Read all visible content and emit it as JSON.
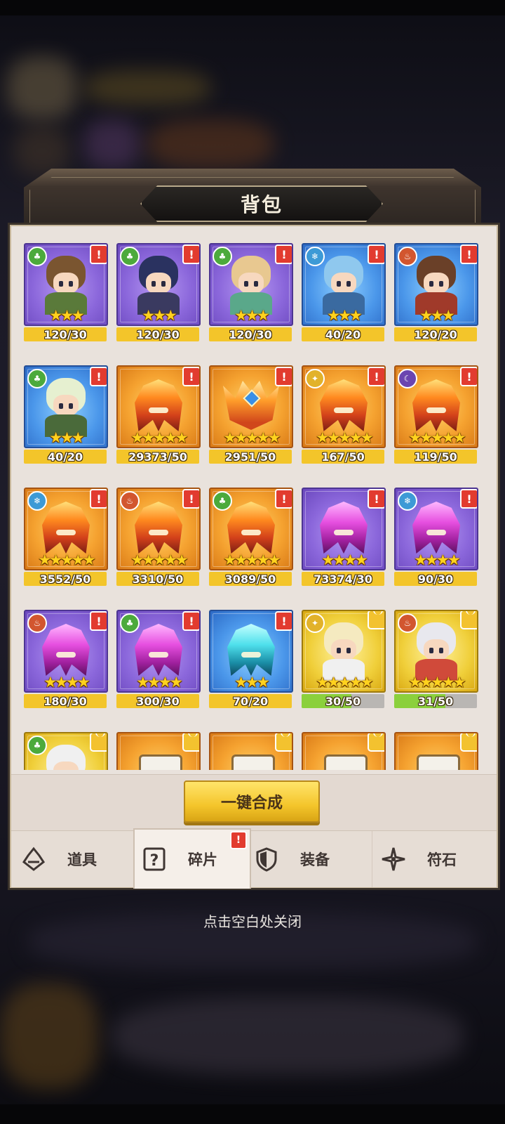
{
  "window": {
    "title": "背包"
  },
  "items": [
    {
      "kind": "hero",
      "rarity": "purple",
      "element": "green",
      "badge": "alert",
      "stars": 3,
      "count": "120/30",
      "hair": "#7a5530",
      "cloth": "#5a7a3a"
    },
    {
      "kind": "hero",
      "rarity": "purple",
      "element": "green",
      "badge": "alert",
      "stars": 3,
      "count": "120/30",
      "hair": "#2a3260",
      "cloth": "#3a3a60"
    },
    {
      "kind": "hero",
      "rarity": "purple",
      "element": "green",
      "badge": "alert",
      "stars": 3,
      "count": "120/30",
      "hair": "#e8c890",
      "cloth": "#5aa88a"
    },
    {
      "kind": "hero",
      "rarity": "blue",
      "element": "ice",
      "badge": "alert",
      "stars": 3,
      "count": "40/20",
      "hair": "#8fc8ee",
      "cloth": "#3a6aa0"
    },
    {
      "kind": "hero",
      "rarity": "blue",
      "element": "fire",
      "badge": "alert",
      "stars": 3,
      "count": "120/20",
      "hair": "#6a4028",
      "cloth": "#a03a2a"
    },
    {
      "kind": "hero",
      "rarity": "blue",
      "element": "green",
      "badge": "alert",
      "stars": 3,
      "count": "40/20",
      "hair": "#e6f0d0",
      "cloth": "#4a6a3a"
    },
    {
      "kind": "helm",
      "rarity": "orange",
      "style": "fire",
      "badge": "alert",
      "stars": 5,
      "count": "29373/50"
    },
    {
      "kind": "crown",
      "rarity": "orange",
      "badge": "alert",
      "stars": 5,
      "count": "2951/50"
    },
    {
      "kind": "helm",
      "rarity": "orange",
      "style": "fire",
      "element": "light",
      "badge": "alert",
      "stars": 5,
      "count": "167/50"
    },
    {
      "kind": "helm",
      "rarity": "orange",
      "style": "fire",
      "element": "dark",
      "badge": "alert",
      "stars": 5,
      "count": "119/50"
    },
    {
      "kind": "helm",
      "rarity": "orange",
      "style": "fire",
      "element": "ice",
      "badge": "alert",
      "stars": 5,
      "count": "3552/50"
    },
    {
      "kind": "helm",
      "rarity": "orange",
      "style": "fire",
      "element": "fire",
      "badge": "alert",
      "stars": 5,
      "count": "3310/50"
    },
    {
      "kind": "helm",
      "rarity": "orange",
      "style": "fire",
      "element": "green",
      "badge": "alert",
      "stars": 5,
      "count": "3089/50"
    },
    {
      "kind": "helm",
      "rarity": "purple",
      "style": "pink",
      "badge": "alert",
      "stars": 4,
      "count": "73374/30"
    },
    {
      "kind": "helm",
      "rarity": "purple",
      "style": "pink",
      "element": "ice",
      "badge": "alert",
      "stars": 4,
      "count": "90/30"
    },
    {
      "kind": "helm",
      "rarity": "purple",
      "style": "pink",
      "element": "fire",
      "badge": "alert",
      "stars": 4,
      "count": "180/30"
    },
    {
      "kind": "helm",
      "rarity": "purple",
      "style": "pink",
      "element": "green",
      "badge": "alert",
      "stars": 4,
      "count": "300/30"
    },
    {
      "kind": "helm",
      "rarity": "blue",
      "style": "cyan",
      "badge": "alert",
      "stars": 3,
      "count": "70/20"
    },
    {
      "kind": "hero",
      "rarity": "gold",
      "element": "light",
      "badge": "puzzle",
      "stars": 5,
      "count": "30/50",
      "progress": 0.6,
      "hair": "#f5eac0",
      "cloth": "#f0f0f0"
    },
    {
      "kind": "hero",
      "rarity": "gold",
      "element": "fire",
      "badge": "puzzle",
      "stars": 5,
      "count": "31/50",
      "progress": 0.62,
      "hair": "#e8e8ee",
      "cloth": "#d04a3a"
    },
    {
      "kind": "hero",
      "rarity": "gold",
      "element": "green",
      "badge": "puzzle",
      "stars": 0,
      "count": "",
      "hair": "#f0f0f0",
      "cloth": "#f0f0f0"
    },
    {
      "kind": "box",
      "rarity": "orange",
      "badge": "puzzle",
      "stars": 0,
      "count": ""
    },
    {
      "kind": "box",
      "rarity": "orange",
      "badge": "puzzle",
      "stars": 0,
      "count": ""
    },
    {
      "kind": "box",
      "rarity": "orange",
      "badge": "puzzle",
      "stars": 0,
      "count": ""
    },
    {
      "kind": "box",
      "rarity": "orange",
      "badge": "puzzle",
      "stars": 0,
      "count": ""
    }
  ],
  "element_glyphs": {
    "green": "♣",
    "ice": "❄",
    "fire": "♨",
    "light": "✦",
    "dark": "☾"
  },
  "merge_button": {
    "label": "一键合成"
  },
  "tabs": [
    {
      "label": "道具",
      "icon": "potion-icon",
      "active": false,
      "alert": ""
    },
    {
      "label": "碎片",
      "icon": "question-card-icon",
      "active": true,
      "alert": "!"
    },
    {
      "label": "装备",
      "icon": "shield-icon",
      "active": false,
      "alert": ""
    },
    {
      "label": "符石",
      "icon": "rune-star-icon",
      "active": false,
      "alert": ""
    }
  ],
  "close_hint": "点击空白处关闭",
  "alert_glyph": "!",
  "star_glyph": "★"
}
